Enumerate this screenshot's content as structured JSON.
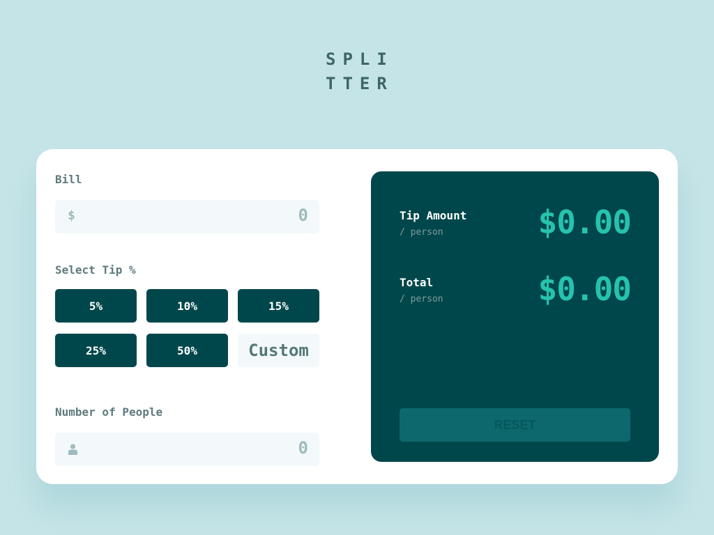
{
  "logo": {
    "line1": "SPLI",
    "line2": "TTER"
  },
  "bill": {
    "label": "Bill",
    "prefix_icon": "dollar-icon",
    "prefix": "$",
    "value": "0"
  },
  "tip": {
    "label": "Select Tip %",
    "options": [
      "5%",
      "10%",
      "15%",
      "25%",
      "50%"
    ],
    "custom_placeholder": "Custom"
  },
  "people": {
    "label": "Number of People",
    "icon": "person-icon",
    "value": "0"
  },
  "results": {
    "tip_amount": {
      "title": "Tip Amount",
      "sub": "/ person",
      "value": "$0.00"
    },
    "total": {
      "title": "Total",
      "sub": "/ person",
      "value": "$0.00"
    },
    "reset_label": "RESET"
  },
  "colors": {
    "background": "#c5e4e7",
    "dark_cyan": "#00474b",
    "accent": "#26c2ae",
    "input_bg": "#f3f9fa"
  }
}
